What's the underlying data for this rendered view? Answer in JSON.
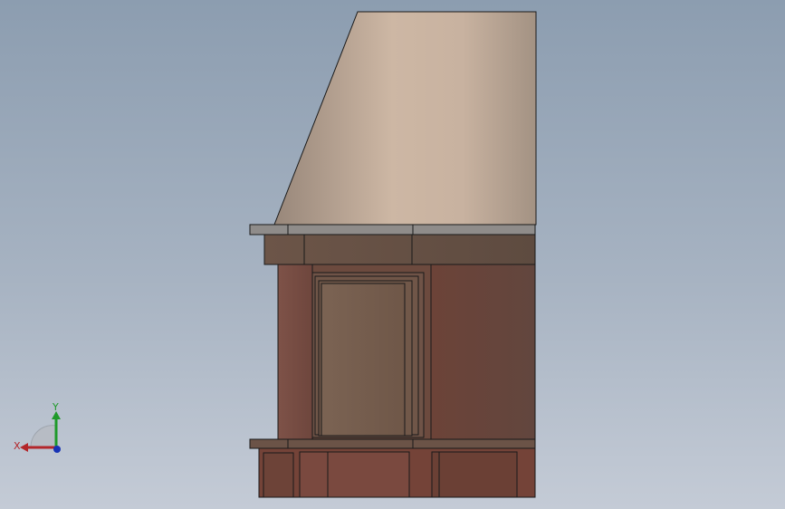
{
  "viewport": {
    "background_top": "#8c9db0",
    "background_bottom": "#c4cbd6"
  },
  "model": {
    "name": "fireplace-side-view",
    "colors": {
      "hood_light": "#cdb6a3",
      "hood_dark": "#a69483",
      "mantel": "#8f8c8a",
      "brick_base": "#6b4239",
      "frame_dark": "#2d1c19",
      "door_inner": "#77614f",
      "wood_band": "#6a5648"
    }
  },
  "triad": {
    "x_label": "X",
    "y_label": "Y",
    "x_color": "#b3262a",
    "y_color": "#1f9a2a",
    "z_color": "#1733b5",
    "origin_icon": "coordinate-triad-icon"
  }
}
